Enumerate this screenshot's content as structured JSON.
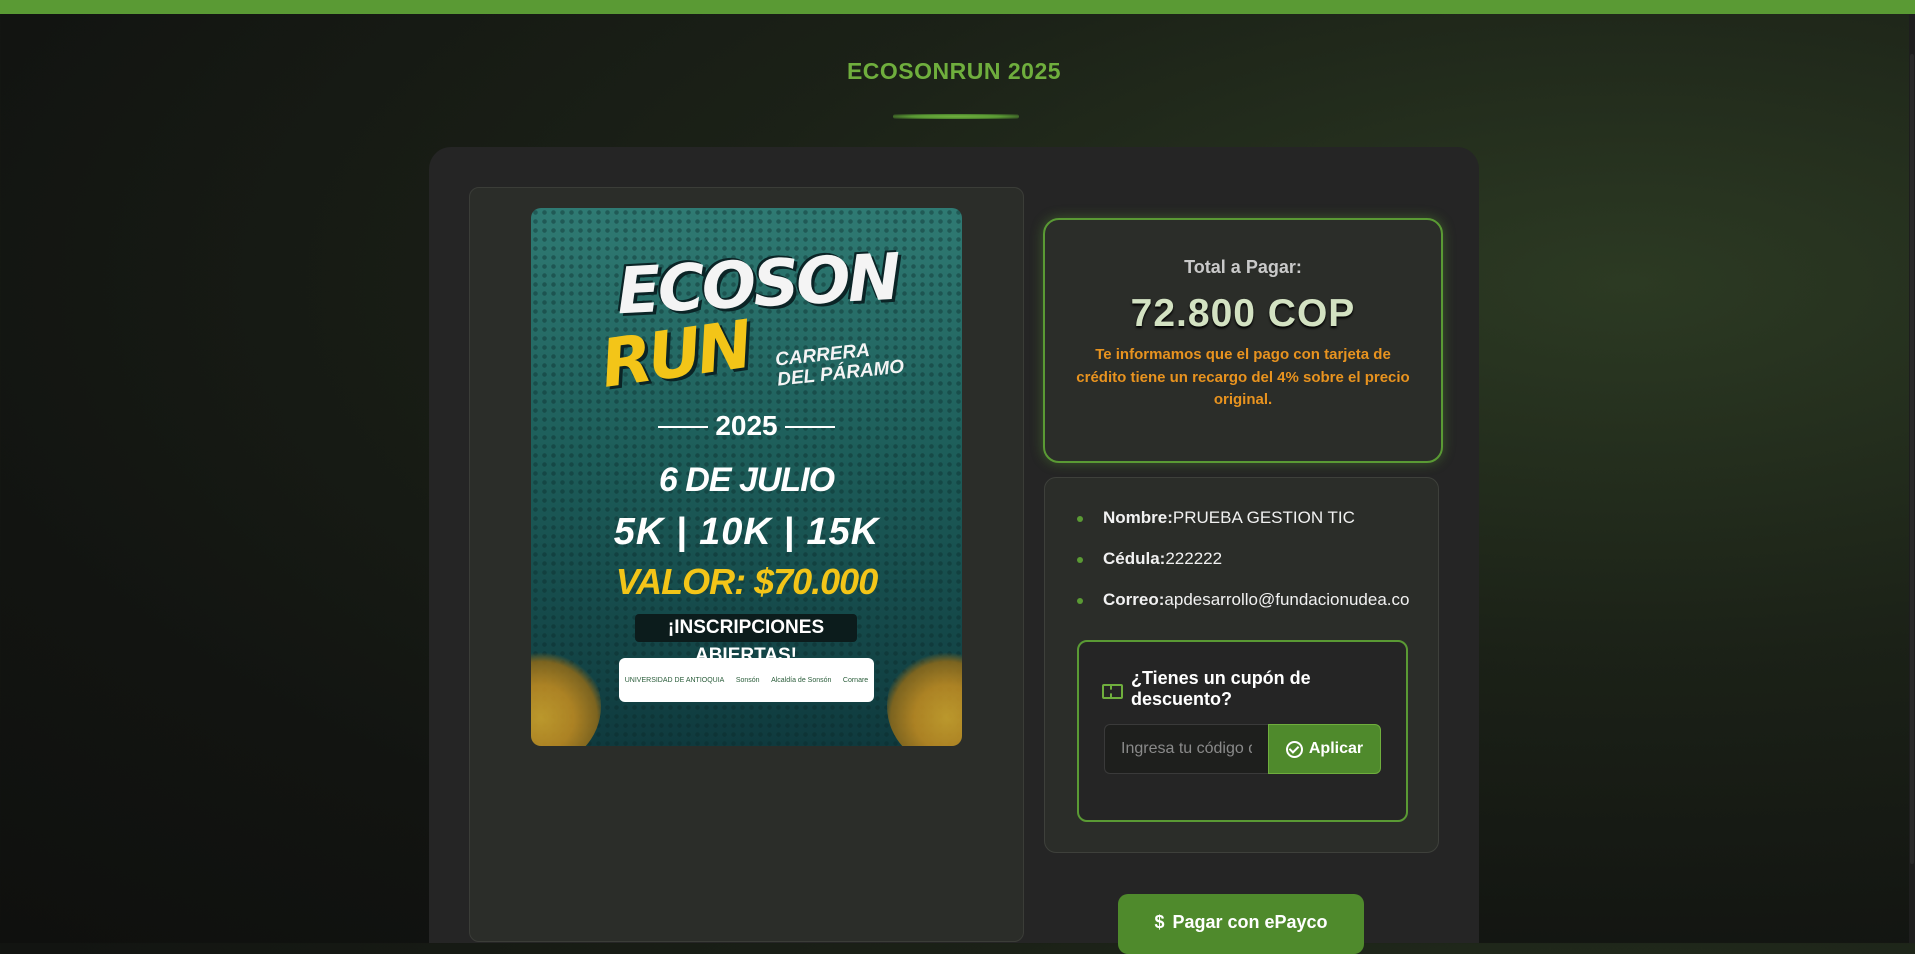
{
  "header": {
    "title": "ECOSONRUN 2025"
  },
  "poster": {
    "ecoson": "ECOSON",
    "run": "RUN",
    "carrera_line1": "CARRERA",
    "carrera_line2": "DEL PÁRAMO",
    "year": "2025",
    "date": "6 DE JULIO",
    "distances": "5K | 10K | 15K",
    "price": "VALOR: $70.000",
    "inscriptions": "¡INSCRIPCIONES ABIERTAS!",
    "sponsors": [
      "UNIVERSIDAD DE ANTIOQUIA",
      "Sonsón",
      "Alcaldía de Sonsón",
      "Cornare"
    ]
  },
  "payment": {
    "total_label": "Total a Pagar:",
    "total_amount": "72.800 COP",
    "note": "Te informamos que el pago con tarjeta de crédito tiene un recargo del 4% sobre el precio original."
  },
  "user": {
    "name_label": "Nombre:",
    "name_value": "PRUEBA GESTION TIC",
    "id_label": "Cédula:",
    "id_value": "222222",
    "email_label": "Correo:",
    "email_value": "apdesarrollo@fundacionudea.co"
  },
  "coupon": {
    "title": "¿Tienes un cupón de descuento?",
    "placeholder": "Ingresa tu código de descuento",
    "apply_label": "Aplicar",
    "icon": "ticket-icon"
  },
  "pay_button": {
    "symbol": "$",
    "label": "Pagar con ePayco"
  },
  "colors": {
    "accent": "#5a9a34",
    "title": "#6fae3d",
    "warning": "#e8931f",
    "amount": "#d3e2c2"
  }
}
